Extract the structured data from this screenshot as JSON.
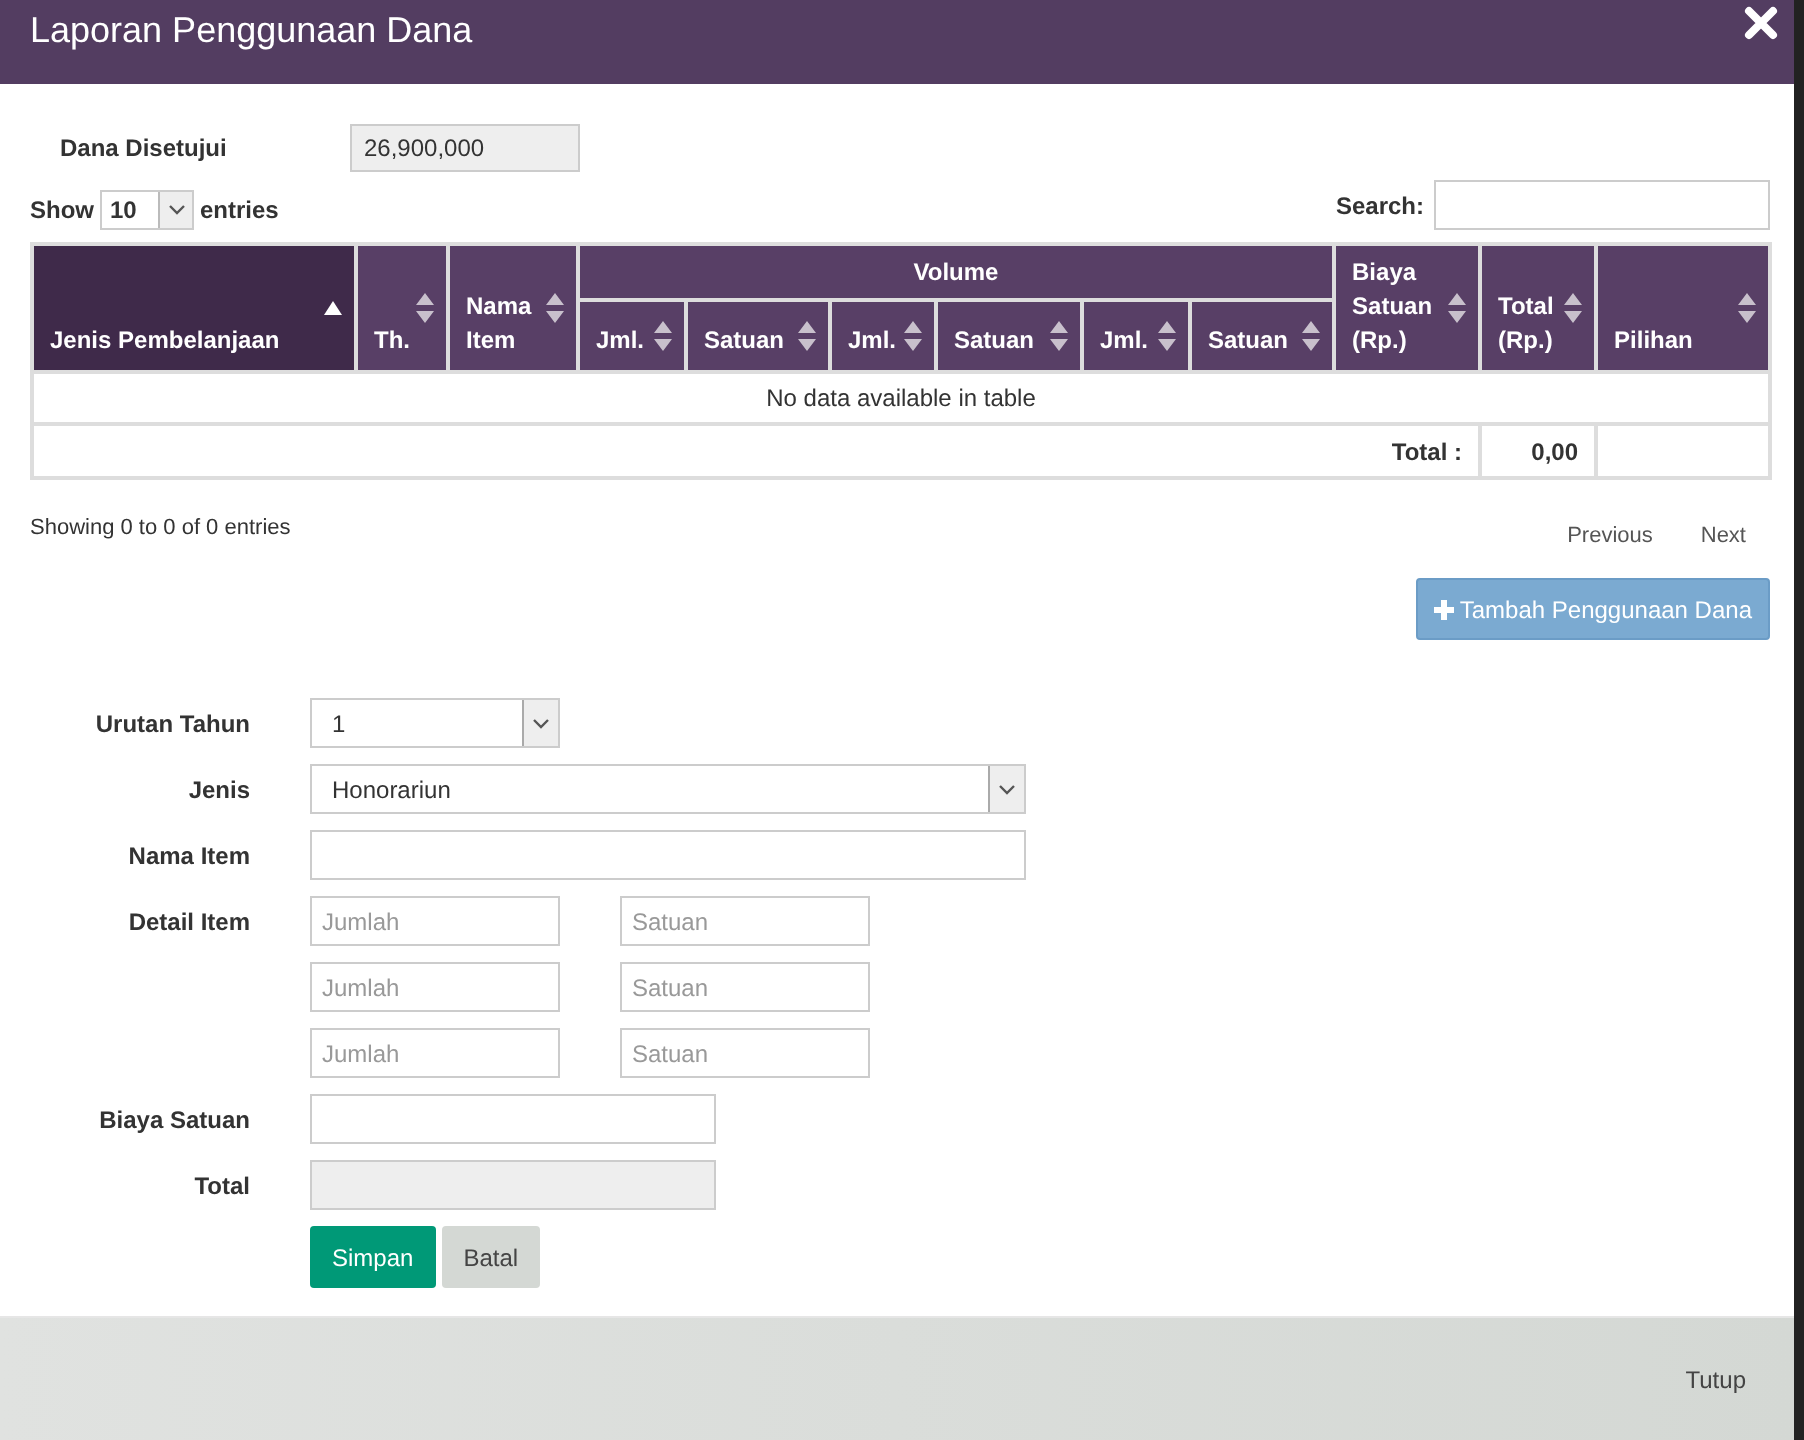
{
  "dialog": {
    "title": "Laporan Penggunaan Dana"
  },
  "approved": {
    "label": "Dana Disetujui",
    "value": "26,900,000"
  },
  "length": {
    "prefix": "Show",
    "value": "10",
    "suffix": "entries"
  },
  "search": {
    "label": "Search:"
  },
  "table": {
    "columns": [
      {
        "label": "Jenis Pembelanjaan",
        "sorted": true
      },
      {
        "label": "Th.",
        "sorted": false
      },
      {
        "label": "Nama Item",
        "sorted": false
      },
      {
        "label": "Volume",
        "children": [
          {
            "label": "Jml.",
            "sorted": false
          },
          {
            "label": "Satuan",
            "sorted": false
          },
          {
            "label": "Jml.",
            "sorted": false
          },
          {
            "label": "Satuan",
            "sorted": false
          },
          {
            "label": "Jml.",
            "sorted": false
          },
          {
            "label": "Satuan",
            "sorted": false
          }
        ]
      },
      {
        "label": "Biaya Satuan (Rp.)",
        "sorted": false
      },
      {
        "label": "Total (Rp.)",
        "sorted": false
      },
      {
        "label": "Pilihan",
        "sorted": false
      }
    ],
    "empty": "No data available in table",
    "footer": {
      "label": "Total :",
      "value": "0,00"
    }
  },
  "info": "Showing 0 to 0 of 0 entries",
  "pager": [
    "Previous",
    "Next"
  ],
  "add_button": "Tambah Penggunaan Dana",
  "form": {
    "rows": [
      {
        "kind": "short-select",
        "label": "Urutan Tahun",
        "value": "1"
      },
      {
        "kind": "select",
        "label": "Jenis",
        "value": "Honorariun"
      },
      {
        "kind": "text",
        "label": "Nama Item"
      },
      {
        "kind": "detail",
        "label": "Detail Item",
        "lines": [
          {
            "amount_placeholder": "Jumlah",
            "unit_placeholder": "Satuan"
          },
          {
            "amount_placeholder": "Jumlah",
            "unit_placeholder": "Satuan"
          },
          {
            "amount_placeholder": "Jumlah",
            "unit_placeholder": "Satuan"
          }
        ]
      },
      {
        "kind": "money",
        "label": "Biaya Satuan"
      },
      {
        "kind": "readonly",
        "label": "Total"
      }
    ],
    "buttons": [
      {
        "label": "Simpan",
        "kind": "primary"
      },
      {
        "label": "Batal",
        "kind": "default"
      }
    ]
  },
  "close_button": "Tutup"
}
